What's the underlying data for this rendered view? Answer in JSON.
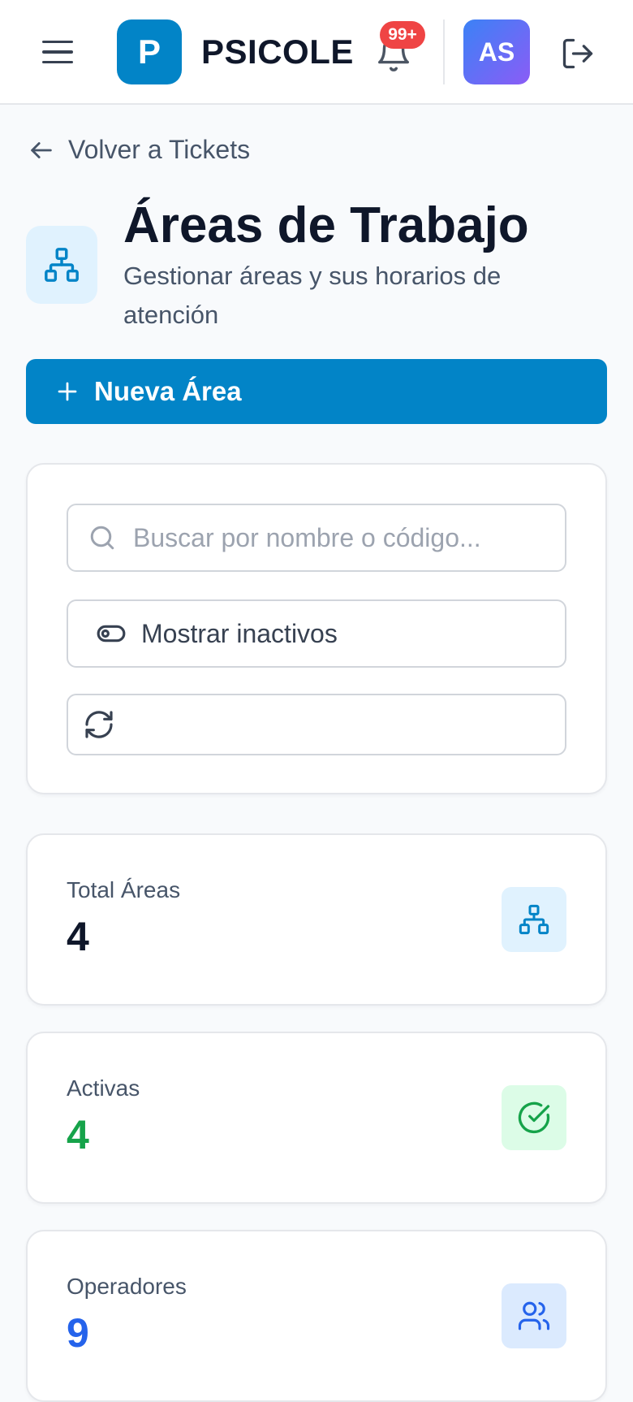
{
  "header": {
    "logo_letter": "P",
    "brand": "PSICOLE",
    "notifications_badge": "99+",
    "avatar_initials": "AS"
  },
  "nav": {
    "back_label": "Volver a Tickets"
  },
  "page": {
    "title": "Áreas de Trabajo",
    "subtitle": "Gestionar áreas y sus horarios de atención",
    "new_button_label": "Nueva Área"
  },
  "filters": {
    "search_placeholder": "Buscar por nombre o código...",
    "search_value": "",
    "show_inactive_label": "Mostrar inactivos"
  },
  "stats": [
    {
      "label": "Total Áreas",
      "value": "4",
      "icon": "sitemap-icon",
      "value_color": "#0f172a",
      "icon_bg": "#e0f2fe",
      "icon_color": "#0284c7"
    },
    {
      "label": "Activas",
      "value": "4",
      "icon": "check-circle-icon",
      "value_color": "#16a34a",
      "icon_bg": "#dcfce7",
      "icon_color": "#16a34a"
    },
    {
      "label": "Operadores",
      "value": "9",
      "icon": "users-icon",
      "value_color": "#2563eb",
      "icon_bg": "#dbeafe",
      "icon_color": "#2563eb"
    }
  ],
  "colors": {
    "primary": "#0284c7",
    "badge": "#ef4444"
  }
}
